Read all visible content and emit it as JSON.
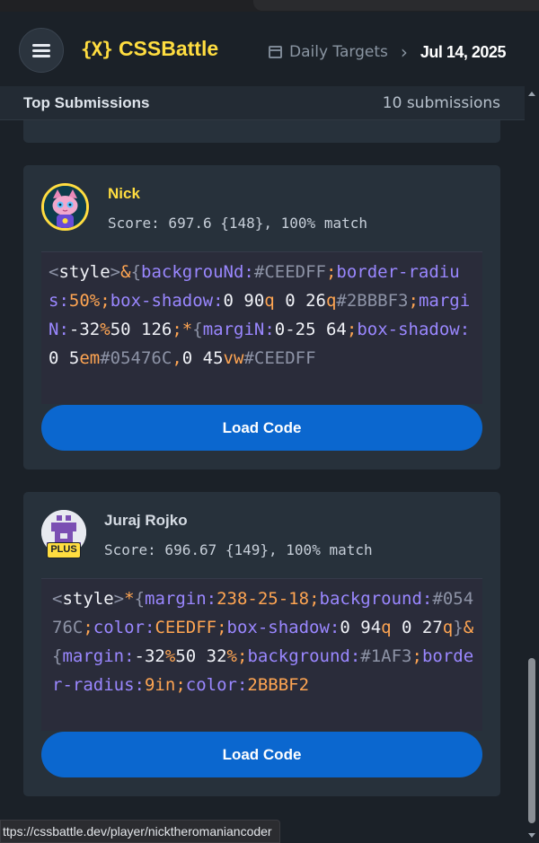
{
  "header": {
    "logo_mark": "{X}",
    "logo_text": "CSSBattle",
    "breadcrumb_daily": "Daily Targets",
    "breadcrumb_sep": "›",
    "breadcrumb_date": "Jul 14, 2025"
  },
  "section": {
    "title": "Top Submissions",
    "count": "10 submissions"
  },
  "submissions": [
    {
      "name": "Nick",
      "score": "Score: 697.6 {148}, 100% match",
      "load_label": "Load Code",
      "code": [
        {
          "t": "<",
          "c": "c-tag"
        },
        {
          "t": "style",
          "c": "c-name"
        },
        {
          "t": ">",
          "c": "c-tag"
        },
        {
          "t": "&",
          "c": "c-val"
        },
        {
          "t": "{",
          "c": "c-tag"
        },
        {
          "t": "backgrouNd",
          "c": "c-prop"
        },
        {
          "t": ":",
          "c": "c-prop"
        },
        {
          "t": "#",
          "c": "c-hash"
        },
        {
          "t": "CEEDFF",
          "c": "c-hash"
        },
        {
          "t": ";",
          "c": "c-val"
        },
        {
          "t": "border-radius",
          "c": "c-prop"
        },
        {
          "t": ":",
          "c": "c-prop"
        },
        {
          "t": "50%",
          "c": "c-val"
        },
        {
          "t": ";",
          "c": "c-val"
        },
        {
          "t": "box-shadow",
          "c": "c-prop"
        },
        {
          "t": ":",
          "c": "c-prop"
        },
        {
          "t": "0 90",
          "c": "c-hex"
        },
        {
          "t": "q",
          "c": "c-val"
        },
        {
          "t": " 0 26",
          "c": "c-hex"
        },
        {
          "t": "q",
          "c": "c-val"
        },
        {
          "t": "#",
          "c": "c-hash"
        },
        {
          "t": "2BBBF3",
          "c": "c-hash"
        },
        {
          "t": ";",
          "c": "c-val"
        },
        {
          "t": "margiN",
          "c": "c-prop"
        },
        {
          "t": ":",
          "c": "c-prop"
        },
        {
          "t": "-32",
          "c": "c-hex"
        },
        {
          "t": "%",
          "c": "c-val"
        },
        {
          "t": "50 126",
          "c": "c-hex"
        },
        {
          "t": ";",
          "c": "c-val"
        },
        {
          "t": "*",
          "c": "c-val"
        },
        {
          "t": "{",
          "c": "c-tag"
        },
        {
          "t": "margiN",
          "c": "c-prop"
        },
        {
          "t": ":",
          "c": "c-prop"
        },
        {
          "t": "0-25 64",
          "c": "c-hex"
        },
        {
          "t": ";",
          "c": "c-val"
        },
        {
          "t": "box-shadow",
          "c": "c-prop"
        },
        {
          "t": ":",
          "c": "c-prop"
        },
        {
          "t": "0 5",
          "c": "c-hex"
        },
        {
          "t": "em",
          "c": "c-val"
        },
        {
          "t": "#",
          "c": "c-hash"
        },
        {
          "t": "05476C",
          "c": "c-hash"
        },
        {
          "t": ",",
          "c": "c-val"
        },
        {
          "t": "0 45",
          "c": "c-hex"
        },
        {
          "t": "vw",
          "c": "c-val"
        },
        {
          "t": "#",
          "c": "c-hash"
        },
        {
          "t": "CEEDFF",
          "c": "c-hash"
        }
      ]
    },
    {
      "name": "Juraj Rojko",
      "badge": "PLUS",
      "score": "Score: 696.67 {149}, 100% match",
      "load_label": "Load Code",
      "code": [
        {
          "t": "<",
          "c": "c-tag"
        },
        {
          "t": "style",
          "c": "c-name"
        },
        {
          "t": ">",
          "c": "c-tag"
        },
        {
          "t": "*",
          "c": "c-val"
        },
        {
          "t": "{",
          "c": "c-tag"
        },
        {
          "t": "margin",
          "c": "c-prop"
        },
        {
          "t": ":",
          "c": "c-prop"
        },
        {
          "t": "238-25-18",
          "c": "c-val"
        },
        {
          "t": ";",
          "c": "c-val"
        },
        {
          "t": "background",
          "c": "c-prop"
        },
        {
          "t": ":",
          "c": "c-prop"
        },
        {
          "t": "#",
          "c": "c-hash"
        },
        {
          "t": "05476C",
          "c": "c-hash"
        },
        {
          "t": ";",
          "c": "c-val"
        },
        {
          "t": "color",
          "c": "c-prop"
        },
        {
          "t": ":",
          "c": "c-prop"
        },
        {
          "t": "CEEDFF",
          "c": "c-val"
        },
        {
          "t": ";",
          "c": "c-val"
        },
        {
          "t": "box-shadow",
          "c": "c-prop"
        },
        {
          "t": ":",
          "c": "c-prop"
        },
        {
          "t": "0 94",
          "c": "c-hex"
        },
        {
          "t": "q",
          "c": "c-val"
        },
        {
          "t": " 0 27",
          "c": "c-hex"
        },
        {
          "t": "q",
          "c": "c-val"
        },
        {
          "t": "}",
          "c": "c-tag"
        },
        {
          "t": "&",
          "c": "c-val"
        },
        {
          "t": "{",
          "c": "c-tag"
        },
        {
          "t": "margin",
          "c": "c-prop"
        },
        {
          "t": ":",
          "c": "c-prop"
        },
        {
          "t": "-32",
          "c": "c-hex"
        },
        {
          "t": "%",
          "c": "c-val"
        },
        {
          "t": "50 32",
          "c": "c-hex"
        },
        {
          "t": "%",
          "c": "c-val"
        },
        {
          "t": ";",
          "c": "c-val"
        },
        {
          "t": "background",
          "c": "c-prop"
        },
        {
          "t": ":",
          "c": "c-prop"
        },
        {
          "t": "#",
          "c": "c-hash"
        },
        {
          "t": "1AF3",
          "c": "c-hash"
        },
        {
          "t": ";",
          "c": "c-val"
        },
        {
          "t": "border-radius",
          "c": "c-prop"
        },
        {
          "t": ":",
          "c": "c-prop"
        },
        {
          "t": "9",
          "c": "c-val"
        },
        {
          "t": "in",
          "c": "c-val"
        },
        {
          "t": ";",
          "c": "c-val"
        },
        {
          "t": "color",
          "c": "c-prop"
        },
        {
          "t": ":",
          "c": "c-prop"
        },
        {
          "t": "2BBBF2",
          "c": "c-val"
        }
      ]
    }
  ],
  "status_bar": {
    "url": "ttps://cssbattle.dev/player/nicktheromaniancoder"
  },
  "colors": {
    "brand": "#ffdd40",
    "button": "#0b67cf",
    "card": "#27313b",
    "background": "#1b2128"
  }
}
